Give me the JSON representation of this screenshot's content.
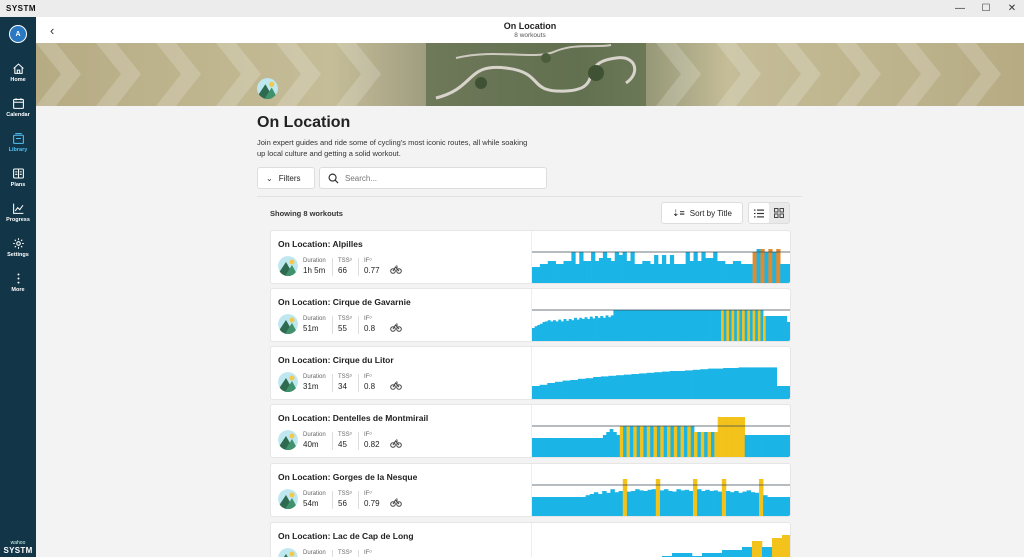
{
  "window": {
    "app_title": "SYSTM",
    "minimize": "—",
    "maximize": "☐",
    "close": "✕"
  },
  "sidebar": {
    "avatar_initial": "A",
    "items": [
      {
        "label": "Home",
        "icon": "home-icon"
      },
      {
        "label": "Calendar",
        "icon": "calendar-icon"
      },
      {
        "label": "Library",
        "icon": "library-icon",
        "active": true
      },
      {
        "label": "Plans",
        "icon": "plans-icon"
      },
      {
        "label": "Progress",
        "icon": "progress-icon"
      },
      {
        "label": "Settings",
        "icon": "gear-icon"
      },
      {
        "label": "More",
        "icon": "more-icon"
      }
    ],
    "brand_small": "wahoo",
    "brand_large": "SYSTM"
  },
  "header": {
    "title": "On Location",
    "subtitle": "8 workouts",
    "back_glyph": "‹"
  },
  "main": {
    "title": "On Location",
    "description": "Join expert guides and ride some of cycling's most iconic routes, all while soaking up local culture and getting a solid workout.",
    "filters_label": "Filters",
    "search_placeholder": "Search...",
    "showing": "Showing 8 workouts",
    "sort_label": "Sort by Title",
    "stat_labels": {
      "duration": "Duration",
      "tss": "TSS",
      "if": "IF"
    }
  },
  "colors": {
    "sidebar_bg": "#123548",
    "accent": "#4fc3f7",
    "profile_blue": "#1ab4e6",
    "profile_orange": "#e38a2c",
    "profile_yellow": "#f3c21b"
  },
  "workouts": [
    {
      "name": "On Location: Alpilles",
      "duration": "1h 5m",
      "tss": "66",
      "if": "0.77",
      "profile": [
        3,
        3,
        3.5,
        3.5,
        4,
        4,
        3.5,
        3.5,
        4,
        4,
        5.5,
        3.5,
        5.5,
        4,
        4,
        5.5,
        4,
        4.5,
        5.5,
        4.5,
        4,
        5.5,
        5,
        5.5,
        4,
        5.5,
        3.5,
        3.5,
        4,
        4,
        3.5,
        5,
        3.5,
        5,
        3.5,
        5,
        3.5,
        3.5,
        3.5,
        5.5,
        4,
        5.5,
        4,
        5.5,
        4.5,
        4.5,
        5.5,
        4,
        4,
        3.5,
        3.5,
        4,
        4,
        3.5,
        3.5,
        3.5,
        5.5,
        6,
        6,
        5.5,
        6,
        5.5,
        6,
        3.5,
        3.5,
        3.5
      ],
      "accent": "orange",
      "accent_from": 56,
      "accent_to": 63,
      "ftp_line": 5.5
    },
    {
      "name": "On Location: Cirque de Gavarnie",
      "duration": "51m",
      "tss": "55",
      "if": "0.8",
      "profile": [
        2.5,
        2.8,
        3,
        3.2,
        3.5,
        3.6,
        3.8,
        3.6,
        3.8,
        3.6,
        3.9,
        3.6,
        4,
        3.7,
        4,
        3.8,
        4.2,
        3.9,
        4.2,
        4,
        4.3,
        4,
        4.4,
        4.1,
        4.5,
        4.2,
        4.5,
        4.2,
        4.6,
        4.3,
        4.6,
        5.5,
        5.5,
        5.5,
        5.5,
        5.5,
        5.5,
        5.5,
        5.5,
        5.5,
        5.5,
        5.5,
        5.5,
        5.5,
        5.5,
        5.5,
        5.5,
        5.5,
        5.5,
        5.5,
        5.5,
        5.5,
        5.5,
        5.5,
        5.5,
        5.5,
        5.5,
        5.5,
        5.5,
        5.5,
        5.5,
        5.5,
        5.5,
        5.5,
        5.5,
        5.5,
        5.5,
        5.5,
        5.5,
        5.5,
        5.5,
        5.5,
        5.5,
        5.5,
        5.5,
        5.5,
        5.5,
        5.5,
        5.5,
        5.5,
        5.5,
        5.5,
        5.5,
        5.5,
        5.5,
        5.5,
        5.5,
        5.5,
        4.5,
        4.5,
        4.5,
        4.5,
        4.5,
        4.5,
        4.5,
        4.5,
        4.5,
        3.5,
        3.5
      ],
      "accent": "yellow",
      "accent_from": 72,
      "accent_to": 89,
      "ftp_line": 5.5
    },
    {
      "name": "On Location: Cirque du Litor",
      "duration": "31m",
      "tss": "34",
      "if": "0.8",
      "profile": [
        2.5,
        2.7,
        3,
        3.2,
        3.4,
        3.5,
        3.7,
        3.8,
        4,
        4.1,
        4.2,
        4.3,
        4.4,
        4.5,
        4.6,
        4.7,
        4.8,
        4.9,
        5,
        5,
        5.1,
        5.2,
        5.3,
        5.4,
        5.4,
        5.5,
        5.5,
        5.6,
        5.6,
        5.6,
        5.6,
        5.6,
        2.5,
        2.5
      ],
      "accent": "none",
      "accent_from": 0,
      "accent_to": 0,
      "ftp_line": 0
    },
    {
      "name": "On Location: Dentelles de Montmirail",
      "duration": "40m",
      "tss": "45",
      "if": "0.82",
      "profile": [
        3.5,
        3.5,
        3.5,
        3.5,
        3.5,
        3.5,
        3.5,
        3.5,
        3.5,
        3.5,
        3.5,
        3.5,
        3.5,
        3.5,
        3.5,
        3.5,
        3.5,
        3.5,
        3.5,
        3.5,
        3.5,
        4,
        4.5,
        5,
        4.5,
        4,
        5.5,
        5.5,
        5.5,
        5.5,
        5.5,
        5.5,
        5.5,
        5.5,
        5.5,
        5.5,
        5.5,
        5.5,
        5.5,
        5.5,
        5.5,
        5.5,
        5.5,
        5.5,
        5.5,
        5.5,
        5.5,
        5.5,
        4.5,
        4.5,
        4.5,
        4.5,
        4.5,
        4.5,
        4.5,
        7,
        7,
        7,
        7,
        7,
        7,
        7,
        7,
        4,
        4,
        4,
        4,
        4,
        4,
        4,
        4,
        4,
        4,
        4,
        4,
        4,
        4
      ],
      "accent": "yellow",
      "accent_from": 26,
      "accent_to": 62,
      "ftp_line": 5.5
    },
    {
      "name": "On Location: Gorges de la Nesque",
      "duration": "54m",
      "tss": "56",
      "if": "0.79",
      "profile": [
        3.5,
        3.5,
        3.5,
        3.5,
        3.5,
        3.5,
        3.5,
        3.5,
        3.5,
        3.5,
        3.5,
        3.5,
        3.5,
        3.8,
        4,
        4.3,
        4,
        4.5,
        4.2,
        4.8,
        4.3,
        4.5,
        6.5,
        4.4,
        4.5,
        4.8,
        4.6,
        4.5,
        4.7,
        4.8,
        6.5,
        4.6,
        4.8,
        4.5,
        4.4,
        4.8,
        4.6,
        4.7,
        4.5,
        6.5,
        4.8,
        4.5,
        4.7,
        4.5,
        4.6,
        4.4,
        6.5,
        4.5,
        4.3,
        4.5,
        4.2,
        4.4,
        4.6,
        4.3,
        4.2,
        6.5,
        3.8,
        3.5,
        3.5,
        3.5,
        3.5,
        3.5,
        3.5
      ],
      "accent": "spikes",
      "accent_from": 0,
      "accent_to": 0,
      "ftp_line": 5.5
    },
    {
      "name": "On Location: Lac de Cap de Long",
      "duration": "",
      "tss": "",
      "if": "",
      "profile": [
        1,
        1,
        1,
        1,
        1,
        1,
        1,
        1.5,
        1.5,
        2,
        2,
        2.5,
        3,
        3.5,
        4,
        4,
        3.5,
        4,
        4,
        4.5,
        4.5,
        5,
        6,
        5,
        6.5,
        7
      ],
      "accent": "none",
      "accent_from": 0,
      "accent_to": 0,
      "ftp_line": 0
    }
  ]
}
